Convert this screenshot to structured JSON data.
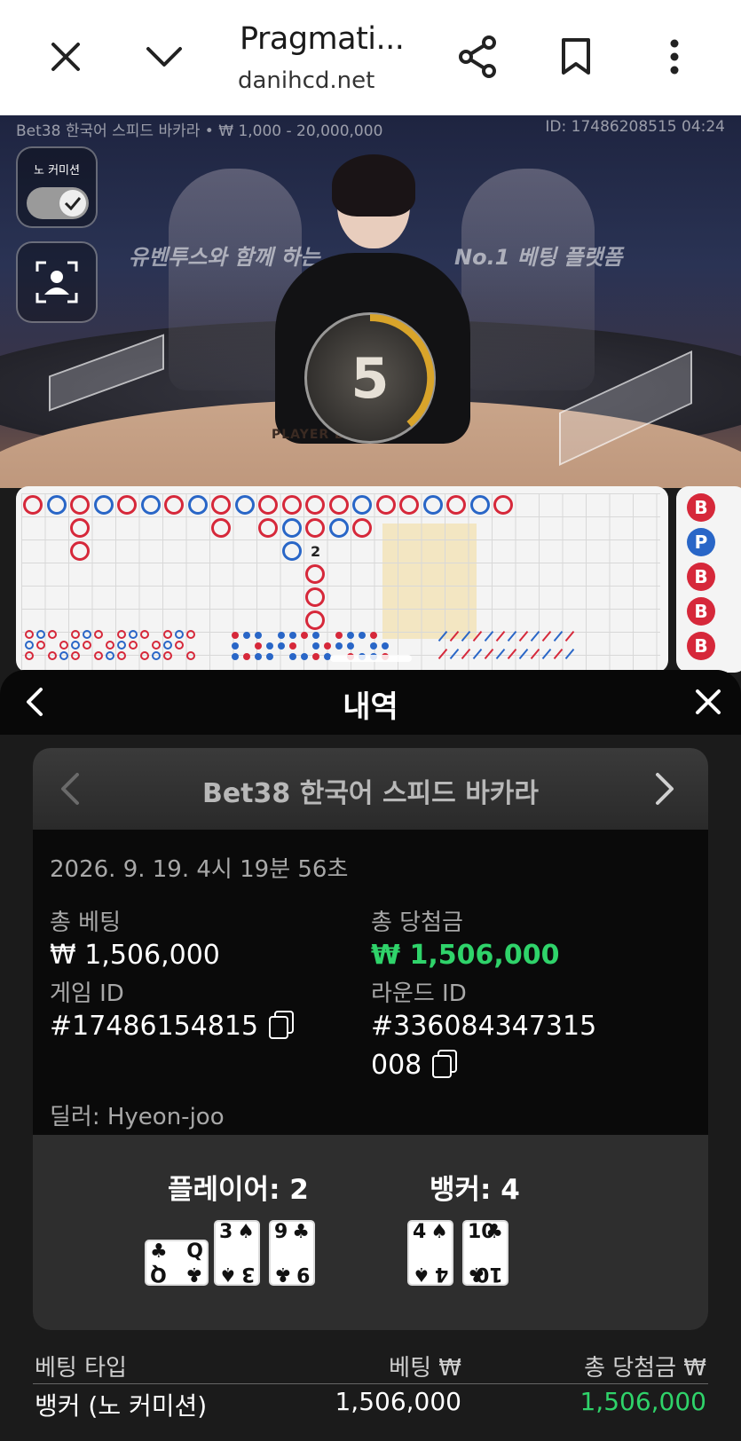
{
  "browser": {
    "title": "Pragmati...",
    "url": "danihcd.net",
    "icons": [
      "close-icon",
      "chevron-down-icon",
      "share-icon",
      "bookmark-icon",
      "more-vert-icon"
    ]
  },
  "stream": {
    "table_info": "Bet38 한국어 스피드 바카라 • ₩ 1,000 - 20,000,000",
    "round_info": "ID: 17486208515 04:24",
    "no_commission_label": "노 커미션",
    "banner_left": "유벤투스와 함께 하는",
    "banner_right": "No.1 베팅 플랫폼",
    "table_label": "PLAYER  BANKER",
    "timer": "5",
    "roadmap_number": "2"
  },
  "right_road": [
    "B",
    "P",
    "B",
    "B",
    "B"
  ],
  "colors": {
    "banker": "#d6283a",
    "player": "#2966c7",
    "win_green": "#2fd36a",
    "timer_gold": "#d9a42a"
  },
  "sheet": {
    "title": "내역",
    "game_name": "Bet38 한국어 스피드 바카라",
    "datetime": "2026. 9. 19. 4시 19분 56초",
    "total_bet_label": "총 베팅",
    "total_bet_value": "₩ 1,506,000",
    "total_win_label": "총 당첨금",
    "total_win_value": "₩ 1,506,000",
    "game_id_label": "게임 ID",
    "game_id_value": "#17486154815",
    "round_id_label": "라운드 ID",
    "round_id_line1": "#336084347315",
    "round_id_line2": "008",
    "dealer_text": "딜러: Hyeon-joo",
    "player_result": "플레이어: 2",
    "banker_result": "뱅커: 4",
    "player_cards": [
      {
        "rank": "Q",
        "suit": "♣"
      },
      {
        "rank": "3",
        "suit": "♠"
      },
      {
        "rank": "9",
        "suit": "♣"
      }
    ],
    "banker_cards": [
      {
        "rank": "4",
        "suit": "♠"
      },
      {
        "rank": "10",
        "suit": "♣"
      }
    ],
    "bets_table": {
      "headers": [
        "베팅 타입",
        "베팅 ₩",
        "총 당첨금 ₩"
      ],
      "rows": [
        {
          "type": "뱅커 (노 커미션)",
          "bet": "1,506,000",
          "win": "1,506,000"
        }
      ]
    }
  }
}
